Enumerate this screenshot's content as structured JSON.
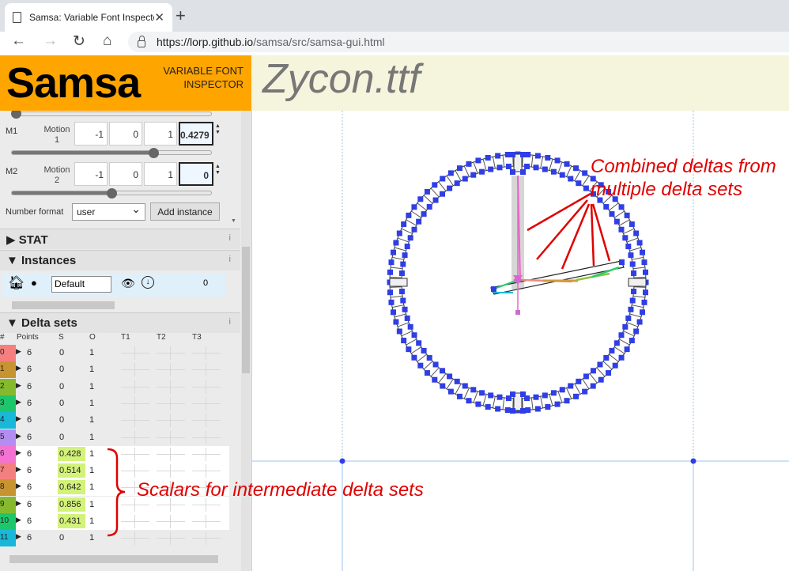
{
  "browser": {
    "tab_title": "Samsa: Variable Font Inspector",
    "tab_close": "✕",
    "new_tab": "+",
    "url_host": "https://lorp.github.io",
    "url_path": "/samsa/src/samsa-gui.html"
  },
  "header": {
    "logo": "Samsa",
    "subtitle": "VARIABLE FONT INSPECTOR",
    "font_name": "Zycon.ttf"
  },
  "axes": [
    {
      "tag": "M1",
      "name": "Motion 1",
      "min": "-1",
      "default": "0",
      "max": "1",
      "current": "0.4279",
      "slider_fraction": 0.71
    },
    {
      "tag": "M2",
      "name": "Motion 2",
      "min": "-1",
      "default": "0",
      "max": "1",
      "current": "0",
      "slider_fraction": 0.5
    }
  ],
  "number_format": {
    "label": "Number format",
    "value": "user"
  },
  "add_instance_label": "Add instance",
  "sections": {
    "stat": "STAT",
    "instances": "Instances",
    "delta_sets": "Delta sets",
    "info_glyph": "i"
  },
  "instance": {
    "name": "Default",
    "count": "0"
  },
  "delta_table": {
    "headers": [
      "#",
      "Points",
      "S",
      "O",
      "T1",
      "T2",
      "T3"
    ],
    "rows": [
      {
        "index": "0",
        "points": "6",
        "scalar": "0",
        "order": "1",
        "color": "#f47f7f",
        "highlight": false
      },
      {
        "index": "1",
        "points": "6",
        "scalar": "0",
        "order": "1",
        "color": "#c89432",
        "highlight": false
      },
      {
        "index": "2",
        "points": "6",
        "scalar": "0",
        "order": "1",
        "color": "#86ba2e",
        "highlight": false
      },
      {
        "index": "3",
        "points": "6",
        "scalar": "0",
        "order": "1",
        "color": "#1ec66b",
        "highlight": false
      },
      {
        "index": "4",
        "points": "6",
        "scalar": "0",
        "order": "1",
        "color": "#1ab8d8",
        "highlight": false
      },
      {
        "index": "5",
        "points": "6",
        "scalar": "0",
        "order": "1",
        "color": "#b38df0",
        "highlight": false
      },
      {
        "index": "6",
        "points": "6",
        "scalar": "0.428",
        "order": "1",
        "color": "#f372d2",
        "highlight": true
      },
      {
        "index": "7",
        "points": "6",
        "scalar": "0.514",
        "order": "1",
        "color": "#f47f7f",
        "highlight": true
      },
      {
        "index": "8",
        "points": "6",
        "scalar": "0.642",
        "order": "1",
        "color": "#c89432",
        "highlight": true
      },
      {
        "index": "9",
        "points": "6",
        "scalar": "0.856",
        "order": "1",
        "color": "#86ba2e",
        "highlight": true
      },
      {
        "index": "10",
        "points": "6",
        "scalar": "0.431",
        "order": "1",
        "color": "#1ec66b",
        "highlight": true
      },
      {
        "index": "11",
        "points": "6",
        "scalar": "0",
        "order": "1",
        "color": "#1ab8d8",
        "highlight": false
      }
    ]
  },
  "annotations": {
    "combined_line1": "Combined deltas from",
    "combined_line2": "multiple delta sets",
    "scalars": "Scalars for intermediate delta sets"
  },
  "colors": {
    "brand_orange": "#ffa500",
    "header_bg": "#f5f4dc",
    "point_blue": "#2f3ee6",
    "annotation_red": "#e00000"
  }
}
